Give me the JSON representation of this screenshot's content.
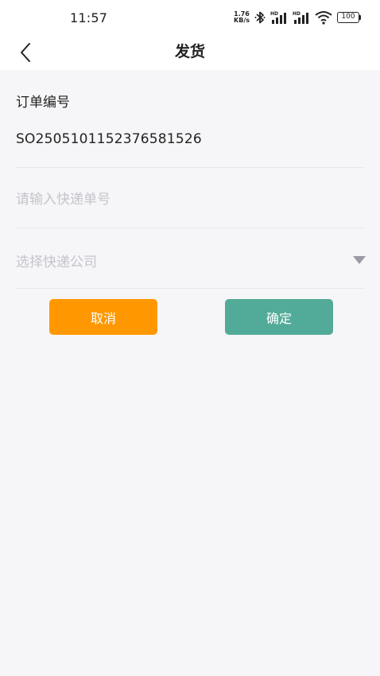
{
  "status_bar": {
    "time": "11:57",
    "net_speed_value": "1.76",
    "net_speed_unit": "KB/s",
    "battery": "100",
    "icons": [
      "bluetooth-icon",
      "signal-hd-icon",
      "signal-hd-icon",
      "wifi-icon"
    ]
  },
  "navbar": {
    "title": "发货",
    "back_icon": "chevron-left-icon"
  },
  "form": {
    "order_label": "订单编号",
    "order_number": "SO2505101152376581526",
    "tracking_placeholder": "请输入快递单号",
    "tracking_value": "",
    "company_placeholder": "选择快递公司",
    "company_icon": "triangle-down-icon"
  },
  "buttons": {
    "cancel": "取消",
    "confirm": "确定"
  },
  "colors": {
    "cancel": "#ff9800",
    "confirm": "#52ab98",
    "background": "#f6f6f8",
    "placeholder": "#c4c4cc"
  }
}
